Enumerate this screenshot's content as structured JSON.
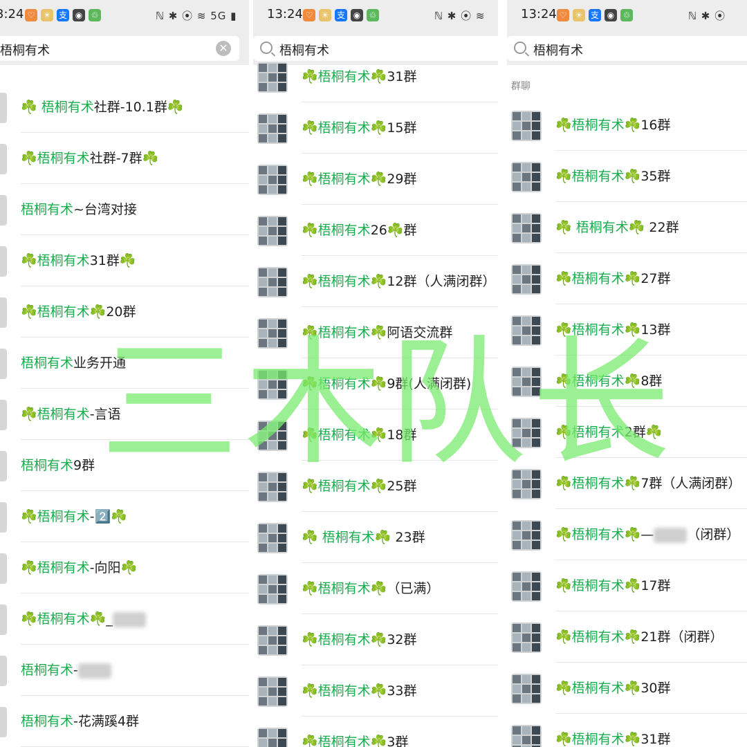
{
  "panels": [
    {
      "status": {
        "time": "3:24",
        "right": "ℕ ✱ ⦿ ≋ 5G ▮"
      },
      "search": {
        "query": "梧桐有术"
      },
      "section": "",
      "rows": [
        {
          "prefix": "☘️ ",
          "keyword": "梧桐有术",
          "rest": "社群-10.1群☘️"
        },
        {
          "prefix": "☘️",
          "keyword": "梧桐有术",
          "rest": "社群-7群☘️"
        },
        {
          "prefix": "",
          "keyword": "梧桐有术",
          "rest": "~台湾对接"
        },
        {
          "prefix": "☘️",
          "keyword": "梧桐有术",
          "rest": "31群☘️"
        },
        {
          "prefix": "☘️",
          "keyword": "梧桐有术",
          "rest": "☘️20群"
        },
        {
          "prefix": "",
          "keyword": "梧桐有术",
          "rest": "业务开通"
        },
        {
          "prefix": "☘️",
          "keyword": "梧桐有术",
          "rest": "-言语"
        },
        {
          "prefix": "",
          "keyword": "梧桐有术",
          "rest": "9群"
        },
        {
          "prefix": "☘️",
          "keyword": "梧桐有术",
          "rest": "-2️⃣☘️"
        },
        {
          "prefix": "☘️",
          "keyword": "梧桐有术",
          "rest": "-向阳☘️"
        },
        {
          "prefix": "☘️",
          "keyword": "梧桐有术",
          "rest": "☘️_"
        },
        {
          "prefix": "",
          "keyword": "梧桐有术",
          "rest": "-"
        },
        {
          "prefix": "",
          "keyword": "梧桐有术",
          "rest": "-花满蹊4群"
        }
      ]
    },
    {
      "status": {
        "time": "13:24",
        "right": "ℕ ✱ ⦿ ≋"
      },
      "search": {
        "query": "梧桐有术"
      },
      "section": "",
      "rows": [
        {
          "prefix": "☘️",
          "keyword": "梧桐有术",
          "rest": "☘️31群"
        },
        {
          "prefix": "☘️",
          "keyword": "梧桐有术",
          "rest": "☘️15群"
        },
        {
          "prefix": "☘️",
          "keyword": "梧桐有术",
          "rest": "☘️29群"
        },
        {
          "prefix": "☘️",
          "keyword": "梧桐有术",
          "rest": "26☘️群"
        },
        {
          "prefix": "☘️",
          "keyword": "梧桐有术",
          "rest": "☘️12群（人满闭群）"
        },
        {
          "prefix": "☘️",
          "keyword": "梧桐有术",
          "rest": "☘️阿语交流群"
        },
        {
          "prefix": "☘️",
          "keyword": "梧桐有术",
          "rest": "☘️9群(人满闭群)"
        },
        {
          "prefix": "☘️",
          "keyword": "梧桐有术",
          "rest": "☘️18群"
        },
        {
          "prefix": "☘️",
          "keyword": "梧桐有术",
          "rest": "☘️25群"
        },
        {
          "prefix": "☘️ ",
          "keyword": "梧桐有术",
          "rest": "☘️ 23群"
        },
        {
          "prefix": "☘️",
          "keyword": "梧桐有术",
          "rest": "☘️（已满）"
        },
        {
          "prefix": "☘️",
          "keyword": "梧桐有术",
          "rest": "☘️32群"
        },
        {
          "prefix": "☘️",
          "keyword": "梧桐有术",
          "rest": "☘️33群"
        },
        {
          "prefix": "☘️",
          "keyword": "梧桐有术",
          "rest": "☘️3群"
        }
      ]
    },
    {
      "status": {
        "time": "13:24",
        "right": "ℕ ✱ ⦿"
      },
      "search": {
        "query": "梧桐有术"
      },
      "section": "群聊",
      "rows": [
        {
          "prefix": "☘️",
          "keyword": "梧桐有术",
          "rest": "☘️16群"
        },
        {
          "prefix": "☘️",
          "keyword": "梧桐有术",
          "rest": "☘️35群"
        },
        {
          "prefix": "☘️ ",
          "keyword": "梧桐有术",
          "rest": "☘️ 22群"
        },
        {
          "prefix": "☘️",
          "keyword": "梧桐有术",
          "rest": "☘️27群"
        },
        {
          "prefix": "☘️",
          "keyword": "梧桐有术",
          "rest": "☘️13群"
        },
        {
          "prefix": "☘️",
          "keyword": "梧桐有术",
          "rest": "☘️8群"
        },
        {
          "prefix": "☘️",
          "keyword": "梧桐有术",
          "rest": "2群☘️"
        },
        {
          "prefix": "☘️",
          "keyword": "梧桐有术",
          "rest": "☘️7群（人满闭群）"
        },
        {
          "prefix": "☘️",
          "keyword": "梧桐有术",
          "rest": "☘️—"
        },
        {
          "prefix": "☘️",
          "keyword": "梧桐有术",
          "rest": "☘️17群"
        },
        {
          "prefix": "☘️",
          "keyword": "梧桐有术",
          "rest": "☘️21群（闭群）"
        },
        {
          "prefix": "☘️",
          "keyword": "梧桐有术",
          "rest": "☘️30群"
        },
        {
          "prefix": "☘️",
          "keyword": "梧桐有术",
          "rest": "☘️31群"
        }
      ]
    }
  ],
  "extra": {
    "panel3_row9_suffix": "（闭群）"
  },
  "watermark": "三木队长",
  "colors": {
    "highlight": "#1aad4e",
    "watermark": "#78eb6e",
    "bar": "#ededed"
  }
}
